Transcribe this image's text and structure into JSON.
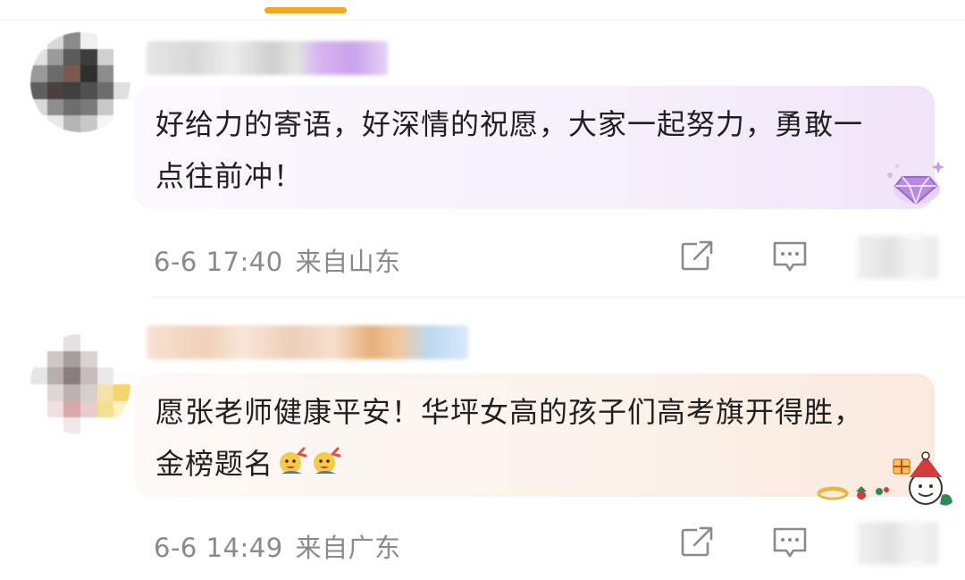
{
  "comments": [
    {
      "text": "好给力的寄语，好深情的祝愿，大家一起努力，勇敢一点往前冲！",
      "time": "6-6 17:40",
      "location": "来自山东"
    },
    {
      "text": "愿张老师健康平安！华坪女高的孩子们高考旗开得胜，金榜题名",
      "time": "6-6 14:49",
      "location": "来自广东"
    }
  ],
  "icons": {
    "share": "share-icon",
    "reply": "reply-icon",
    "emoji": "cheer-emoji-icon",
    "badge_1": "diamond-badge-icon",
    "badge_2": "snowman-gift-badge-icon"
  },
  "colors": {
    "accent": "#f2a91f",
    "meta_text": "#8a8a8a",
    "bubble_1": "#f6f0fb",
    "bubble_2": "#fbf2ea"
  }
}
